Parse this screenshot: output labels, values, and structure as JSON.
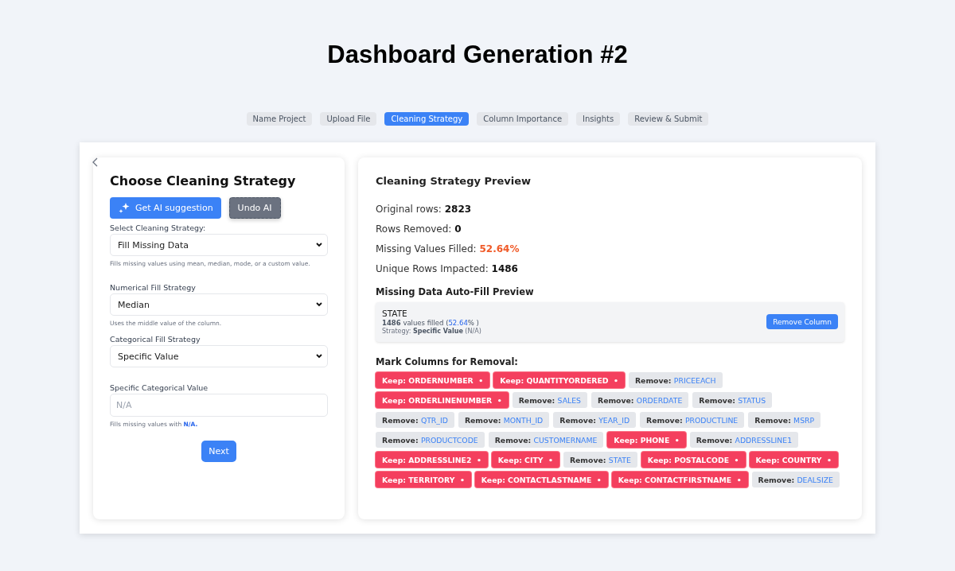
{
  "title": "Dashboard Generation #2",
  "steps": [
    {
      "label": "Name Project",
      "selected": false
    },
    {
      "label": "Upload File",
      "selected": false
    },
    {
      "label": "Cleaning Strategy",
      "selected": true
    },
    {
      "label": "Column Importance",
      "selected": false
    },
    {
      "label": "Insights",
      "selected": false
    },
    {
      "label": "Review & Submit",
      "selected": false
    }
  ],
  "form": {
    "heading": "Choose Cleaning Strategy",
    "ai_button": "Get AI suggestion",
    "undo_button": "Undo AI",
    "fields": [
      {
        "kind": "select",
        "label": "Select Cleaning Strategy:",
        "value": "Fill Missing Data",
        "hint": "Fills missing values using mean, median, mode, or a custom value."
      },
      {
        "kind": "select",
        "label": "Numerical Fill Strategy",
        "value": "Median",
        "hint": "Uses the middle value of the column."
      },
      {
        "kind": "select",
        "label": "Categorical Fill Strategy",
        "value": "Specific Value"
      },
      {
        "kind": "text",
        "label": "Specific Categorical Value",
        "placeholder": "N/A",
        "hint": "Fills missing values with ",
        "hint_value": "N/A."
      }
    ],
    "next_button": "Next"
  },
  "preview": {
    "heading": "Cleaning Strategy Preview",
    "stats": [
      {
        "label": "Original rows:",
        "value": "2823",
        "kind": "plain"
      },
      {
        "label": "Rows Removed:",
        "value": "0",
        "kind": "plain"
      },
      {
        "label": "Missing Values Filled:",
        "value": "52.64%",
        "kind": "highlight"
      },
      {
        "label": "Unique Rows Impacted:",
        "value": "1486",
        "kind": "plain"
      }
    ],
    "autofill_heading": "Missing Data Auto-Fill Preview",
    "autofill": [
      {
        "column": "STATE",
        "count": "1486",
        "count_label": "values filled (",
        "percent": "52.64",
        "percent_suffix": "% )",
        "strategy": "Strategy: **Specific Value** (N/A)",
        "button": "Remove Column"
      }
    ],
    "removal_heading": "Mark Columns for Removal:",
    "chips": [
      {
        "kind": "keep",
        "prefix": "Keep:",
        "name": "ORDERNUMBER",
        "marker": "•"
      },
      {
        "kind": "keep",
        "prefix": "Keep:",
        "name": "QUANTITYORDERED",
        "marker": "•"
      },
      {
        "kind": "remove",
        "prefix": "Remove:",
        "name": "PRICEEACH"
      },
      {
        "kind": "keep",
        "prefix": "Keep:",
        "name": "ORDERLINENUMBER",
        "marker": "•"
      },
      {
        "kind": "remove",
        "prefix": "Remove:",
        "name": "SALES"
      },
      {
        "kind": "remove",
        "prefix": "Remove:",
        "name": "ORDERDATE"
      },
      {
        "kind": "remove",
        "prefix": "Remove:",
        "name": "STATUS"
      },
      {
        "kind": "remove",
        "prefix": "Remove:",
        "name": "QTR_ID"
      },
      {
        "kind": "remove",
        "prefix": "Remove:",
        "name": "MONTH_ID"
      },
      {
        "kind": "remove",
        "prefix": "Remove:",
        "name": "YEAR_ID"
      },
      {
        "kind": "remove",
        "prefix": "Remove:",
        "name": "PRODUCTLINE"
      },
      {
        "kind": "remove",
        "prefix": "Remove:",
        "name": "MSRP"
      },
      {
        "kind": "remove",
        "prefix": "Remove:",
        "name": "PRODUCTCODE"
      },
      {
        "kind": "remove",
        "prefix": "Remove:",
        "name": "CUSTOMERNAME"
      },
      {
        "kind": "keep",
        "prefix": "Keep:",
        "name": "PHONE",
        "marker": "•"
      },
      {
        "kind": "remove",
        "prefix": "Remove:",
        "name": "ADDRESSLINE1"
      },
      {
        "kind": "keep",
        "prefix": "Keep:",
        "name": "ADDRESSLINE2",
        "marker": "•"
      },
      {
        "kind": "keep",
        "prefix": "Keep:",
        "name": "CITY",
        "marker": "•"
      },
      {
        "kind": "remove",
        "prefix": "Remove:",
        "name": "STATE"
      },
      {
        "kind": "keep",
        "prefix": "Keep:",
        "name": "POSTALCODE",
        "marker": "•"
      },
      {
        "kind": "keep",
        "prefix": "Keep:",
        "name": "COUNTRY",
        "marker": "•"
      },
      {
        "kind": "keep",
        "prefix": "Keep:",
        "name": "TERRITORY",
        "marker": "•"
      },
      {
        "kind": "keep",
        "prefix": "Keep:",
        "name": "CONTACTLASTNAME",
        "marker": "•"
      },
      {
        "kind": "keep",
        "prefix": "Keep:",
        "name": "CONTACTFIRSTNAME",
        "marker": "•"
      },
      {
        "kind": "remove",
        "prefix": "Remove:",
        "name": "DEALSIZE"
      }
    ]
  }
}
